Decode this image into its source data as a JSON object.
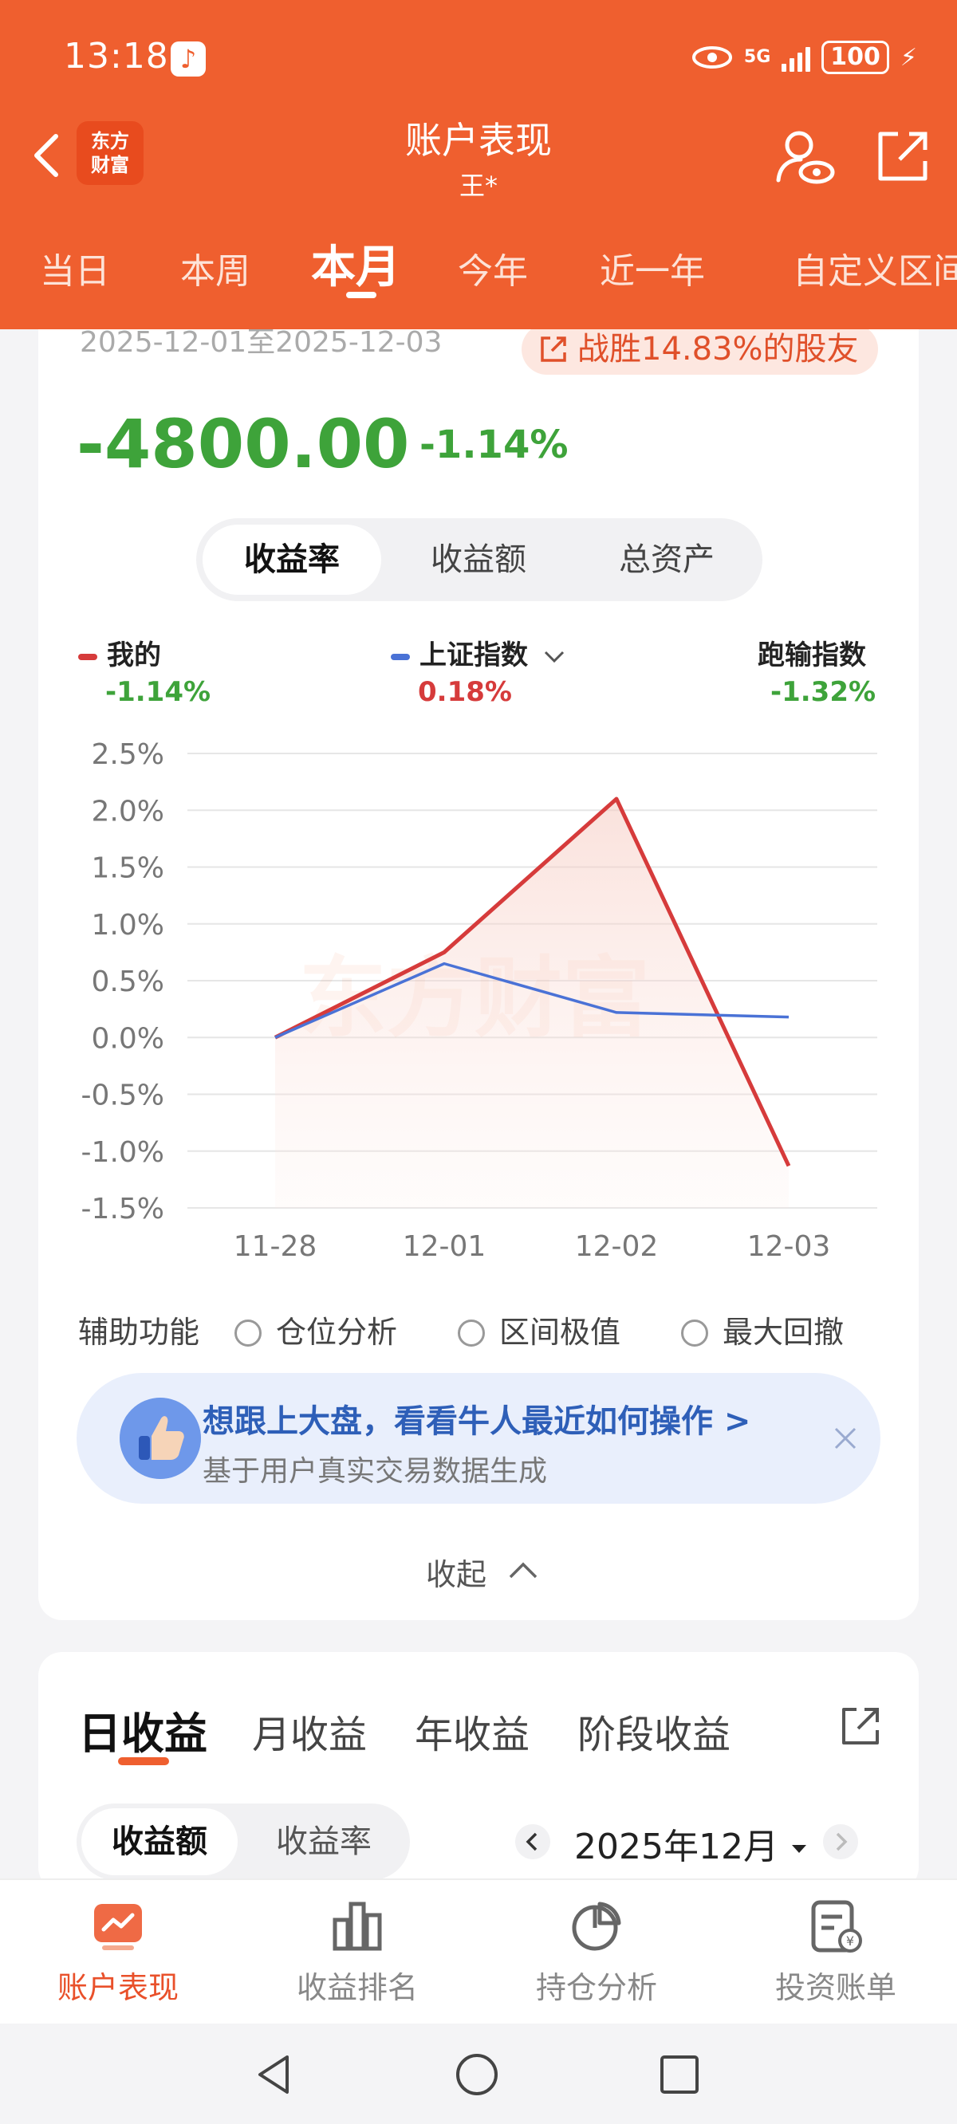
{
  "status_bar": {
    "time": "13:18",
    "signal": "5G",
    "battery": "100"
  },
  "header": {
    "title": "账户表现",
    "subtitle": "王*",
    "logo_text": "东方财富"
  },
  "period_tabs": [
    "当日",
    "本周",
    "本月",
    "今年",
    "近一年",
    "自定义区间"
  ],
  "active_period": "本月",
  "summary": {
    "date_range": "2025-12-01至2025-12-03",
    "beat_text": "战胜14.83%的股友",
    "profit": "-4800.00",
    "return_pct": "-1.14%"
  },
  "metric_tabs": [
    "收益率",
    "收益额",
    "总资产"
  ],
  "active_metric": "收益率",
  "legend": {
    "mine": {
      "label": "我的",
      "value": "-1.14%",
      "color": "#d63b3b"
    },
    "index": {
      "label": "上证指数",
      "value": "0.18%",
      "color": "#4a72d6"
    },
    "loser_index": {
      "label": "跑输指数",
      "value": "-1.32%"
    }
  },
  "chart_data": {
    "type": "line",
    "categories": [
      "11-28",
      "12-01",
      "12-02",
      "12-03"
    ],
    "series": [
      {
        "name": "我的",
        "values": [
          0.0,
          0.75,
          2.1,
          -1.13
        ]
      },
      {
        "name": "上证指数",
        "values": [
          0.0,
          0.65,
          0.22,
          0.18
        ]
      }
    ],
    "y_ticks": [
      "2.5%",
      "2.0%",
      "1.5%",
      "1.0%",
      "0.5%",
      "0.0%",
      "-0.5%",
      "-1.0%",
      "-1.5%"
    ],
    "ylim": [
      -1.5,
      2.5
    ],
    "grid": true,
    "watermark": "东方财富"
  },
  "aux": {
    "label": "辅助功能",
    "options": [
      "仓位分析",
      "区间极值",
      "最大回撤"
    ]
  },
  "promo": {
    "title": "想跟上大盘，看看牛人最近如何操作 >",
    "subtitle": "基于用户真实交易数据生成"
  },
  "collapse_label": "收起",
  "income_tabs": [
    "日收益",
    "月收益",
    "年收益",
    "阶段收益"
  ],
  "income_seg": [
    "收益额",
    "收益率"
  ],
  "month": "2025年12月",
  "bottom_nav": [
    "账户表现",
    "收益排名",
    "持仓分析",
    "投资账单"
  ]
}
